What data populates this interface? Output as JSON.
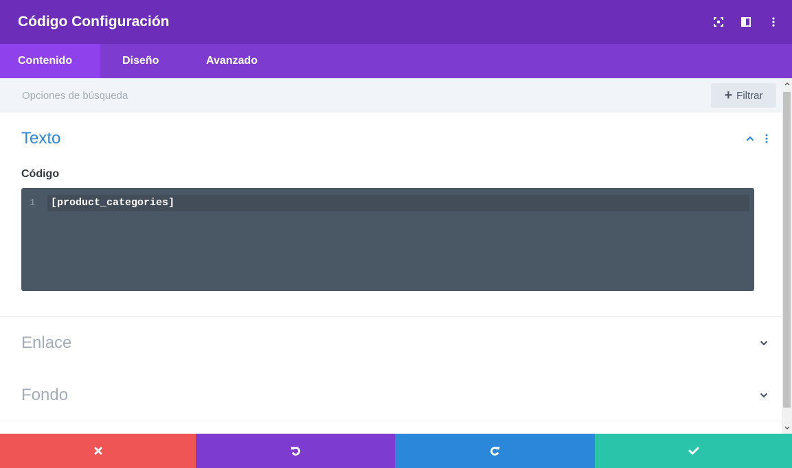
{
  "header": {
    "title": "Código Configuración",
    "icons": [
      "expand-icon",
      "split-view-icon",
      "more-vertical-icon"
    ]
  },
  "tabs": [
    {
      "label": "Contenido",
      "active": true
    },
    {
      "label": "Diseño",
      "active": false
    },
    {
      "label": "Avanzado",
      "active": false
    }
  ],
  "search": {
    "placeholder": "Opciones de búsqueda",
    "filter_label": "Filtrar"
  },
  "sections": {
    "texto": {
      "title": "Texto",
      "expanded": true,
      "field_label": "Código",
      "code": {
        "line_number": "1",
        "text": "[product_categories]"
      }
    },
    "enlace": {
      "title": "Enlace",
      "expanded": false
    },
    "fondo": {
      "title": "Fondo",
      "expanded": false
    }
  },
  "footer": {
    "icons": [
      "close-icon",
      "undo-icon",
      "redo-icon",
      "check-icon"
    ]
  },
  "colors": {
    "header": "#6c2eb9",
    "tabs": "#7e3bd0",
    "active_tab": "#8f42ec",
    "accent_blue": "#2b87da",
    "discard": "#ef5555",
    "save": "#29c4a9"
  }
}
